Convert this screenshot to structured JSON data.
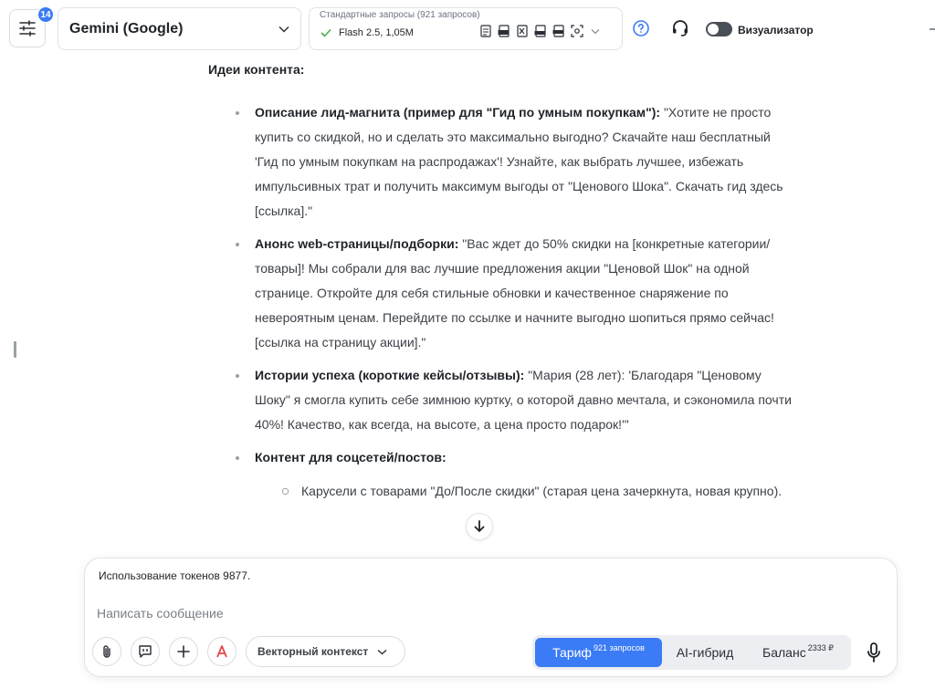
{
  "header": {
    "settings_badge": "14",
    "model_name": "Gemini (Google)",
    "requests_caption": "Стандартные запросы (921 запросов)",
    "requests_value": "Flash 2.5, 1,05M",
    "visualizer_label": "Визуализатор",
    "visualizer_on": false
  },
  "content": {
    "section_title": "Идеи контента:",
    "items": [
      {
        "title": "Описание лид-магнита (пример для \"Гид по умным покупкам\"):",
        "text": " \"Хотите не просто купить со скидкой, но и сделать это максимально выгодно? Скачайте наш бесплатный 'Гид по умным покупкам на распродажах'! Узнайте, как выбрать лучшее, избежать импульсивных трат и получить максимум выгоды от \"Ценового Шока\". Скачать гид здесь [ссылка].\""
      },
      {
        "title": "Анонс web-страницы/подборки:",
        "text": " \"Вас ждет до 50% скидки на [конкретные категории/товары]! Мы собрали для вас лучшие предложения акции \"Ценовой Шок\" на одной странице. Откройте для себя стильные обновки и качественное снаряжение по невероятным ценам. Перейдите по ссылке и начните выгодно шопиться прямо сейчас! [ссылка на страницу акции].\""
      },
      {
        "title": "Истории успеха (короткие кейсы/отзывы):",
        "text": " \"Мария (28 лет): 'Благодаря \"Ценовому Шоку\" я смогла купить себе зимнюю куртку, о которой давно мечтала, и сэкономила почти 40%! Качество, как всегда, на высоте, а цена просто подарок!'\""
      },
      {
        "title": "Контент для соцсетей/постов:",
        "text": ""
      }
    ],
    "sub_items": [
      "Карусели с товарами \"До/После скидки\" (старая цена зачеркнута, новая крупно)."
    ]
  },
  "composer": {
    "token_usage": "Использование токенов 9877.",
    "placeholder": "Написать сообщение",
    "vector_context_label": "Векторный контекст",
    "modes": [
      {
        "label": "Тариф",
        "sup": "921 запросов",
        "active": true
      },
      {
        "label": "AI-гибрид",
        "sup": "",
        "active": false
      },
      {
        "label": "Баланс",
        "sup": "2333 ₽",
        "active": false
      }
    ]
  },
  "colors": {
    "accent": "#3b7bf5",
    "toggle_off": "#4a4f57",
    "check": "#4caf50"
  }
}
